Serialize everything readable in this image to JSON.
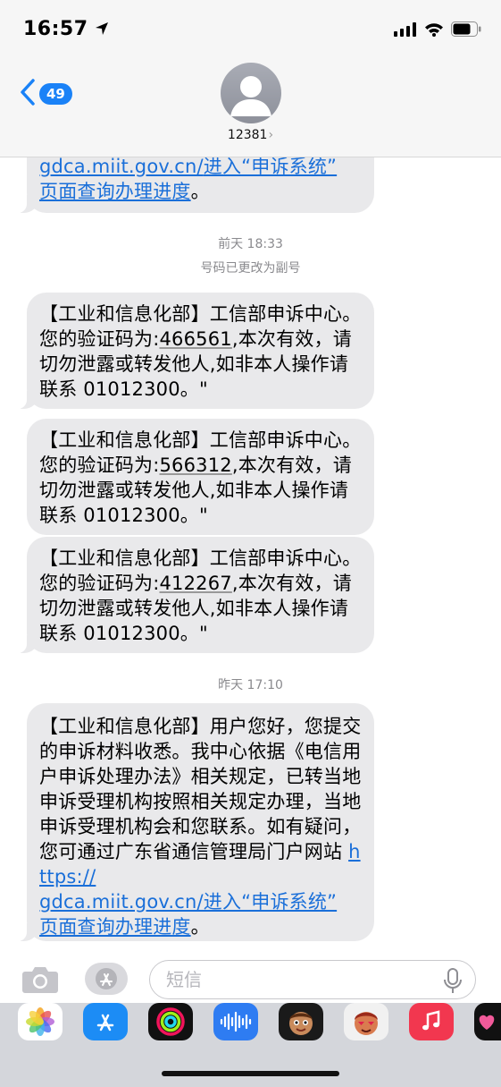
{
  "status_bar": {
    "time": "16:57"
  },
  "header": {
    "back_badge": "49",
    "contact_name": "12381",
    "chevron": "›"
  },
  "messages": {
    "m0": {
      "line1_plain": "",
      "link1": "gdca.miit.gov.cn/",
      "link2": "进入“申诉系统”",
      "link3": "页面查询办理进度",
      "tail_text": "。"
    },
    "ts1": {
      "time": "前天 18:33",
      "note": "号码已更改为副号"
    },
    "m1": {
      "before": "【工业和信息化部】工信部申诉中心。您的验证码为:",
      "code": "466561",
      "after": ",本次有效，请切勿泄露或转发他人,如非本人操作请联系 01012300。\""
    },
    "m2": {
      "before": "【工业和信息化部】工信部申诉中心。您的验证码为:",
      "code": "566312",
      "after": ",本次有效，请切勿泄露或转发他人,如非本人操作请联系 01012300。\""
    },
    "m3": {
      "before": "【工业和信息化部】工信部申诉中心。您的验证码为:",
      "code": "412267",
      "after": ",本次有效，请切勿泄露或转发他人,如非本人操作请联系 01012300。\""
    },
    "ts2": {
      "time": "昨天 17:10"
    },
    "m4": {
      "body": "【工业和信息化部】用户您好，您提交的申诉材料收悉。我中心依据《电信用户申诉处理办法》相关规定，已转当地申诉受理机构按照相关规定办理，当地申诉受理机构会和您联系。如有疑问，您可通过广东省通信管理局门户网站 ",
      "link1": "https://",
      "link2": "gdca.miit.gov.cn/进入“申诉系统”",
      "link3": "页面查询办理进度",
      "tail_text": "。"
    }
  },
  "input": {
    "placeholder": "短信"
  },
  "icons": {
    "camera": "camera-icon",
    "app_store": "app-store-icon",
    "mic": "microphone-icon"
  },
  "colors": {
    "accent": "#1a82f7",
    "bubble": "#e9e9eb",
    "link": "#1a6fd9"
  }
}
